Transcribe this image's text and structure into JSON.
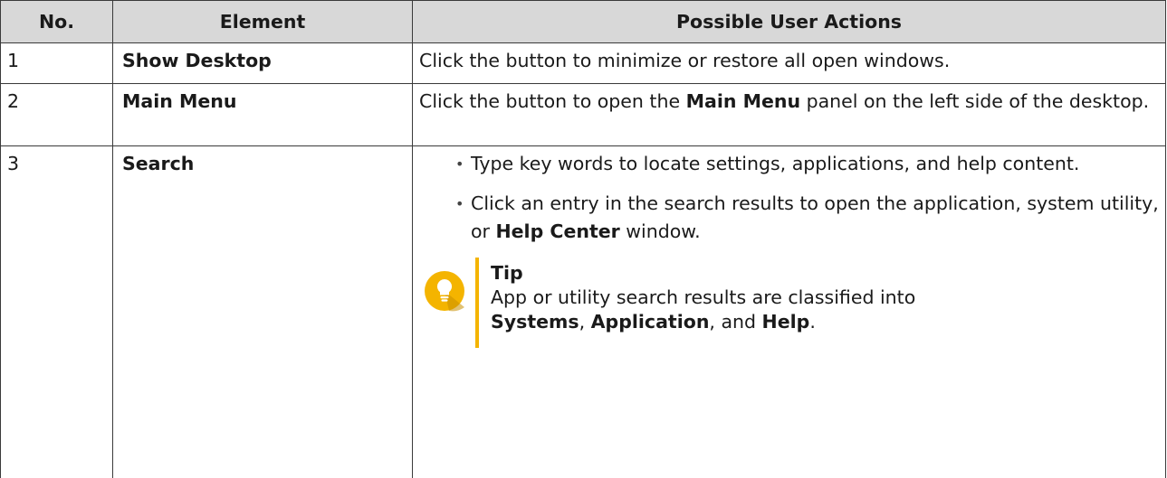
{
  "colors": {
    "header_bg": "#d8d8d8",
    "tip_accent": "#f4b400",
    "border": "#3a3a3a"
  },
  "table": {
    "headers": [
      "No.",
      "Element",
      "Possible User Actions"
    ],
    "rows": [
      {
        "no": "1",
        "element": "Show Desktop",
        "action": "Click the button to minimize or restore all open windows."
      },
      {
        "no": "2",
        "element": "Main Menu",
        "action_pre": "Click the button to open the ",
        "action_bold": "Main Menu",
        "action_post": " panel on the left side of the desktop."
      },
      {
        "no": "3",
        "element": "Search",
        "bullet1": "Type key words to locate settings, applications, and help content.",
        "bullet2_pre": "Click an entry in the search results to open the application, system utility, or ",
        "bullet2_bold": "Help Center",
        "bullet2_post": " window.",
        "tip": {
          "icon": "lightbulb-icon",
          "title": "Tip",
          "text_pre": "App or utility search results are classified into ",
          "b1": "Systems",
          "sep1": ", ",
          "b2": "Application",
          "sep2": ", and ",
          "b3": "Help",
          "end": "."
        }
      }
    ]
  }
}
